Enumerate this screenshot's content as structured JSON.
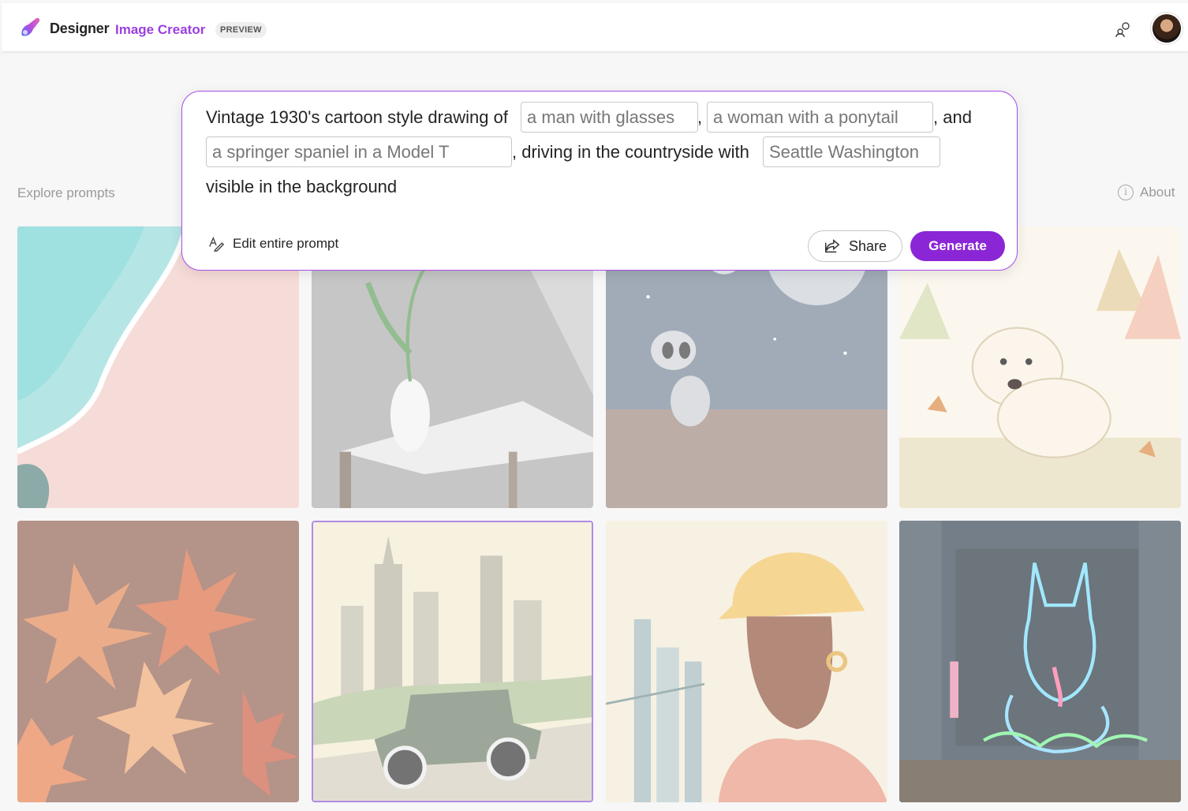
{
  "header": {
    "brand": "Designer",
    "product": "Image Creator",
    "badge": "PREVIEW"
  },
  "explore": {
    "label": "Explore prompts",
    "about_label": "About",
    "about_icon": "info-icon"
  },
  "prompt": {
    "text_1": "Vintage 1930's cartoon style drawing of",
    "field_1": "a man with glasses",
    "sep_1": ",",
    "field_2": "a woman with a ponytail",
    "sep_2": ", and",
    "field_3": "a springer spaniel in a Model T",
    "text_2": ", driving in the countryside with",
    "field_4": "Seattle Washington",
    "text_3": "visible in the background",
    "edit_label": "Edit entire prompt",
    "share_label": "Share",
    "generate_label": "Generate"
  },
  "colors": {
    "accent": "#8b26d6",
    "brand_purple": "#9b3fe0"
  },
  "gallery": [
    {
      "subject": "aerial beach with turquoise water and pink sand"
    },
    {
      "subject": "pink tulip in white vase on table"
    },
    {
      "subject": "cute alien sitting on planet with moons"
    },
    {
      "subject": "fluffy puppy in autumn leaves"
    },
    {
      "subject": "orange maple leaves"
    },
    {
      "subject": "vintage car driving in front of city skyline"
    },
    {
      "subject": "woman in yellow hard hat with cranes"
    },
    {
      "subject": "neon german shepherd sign in city"
    }
  ]
}
